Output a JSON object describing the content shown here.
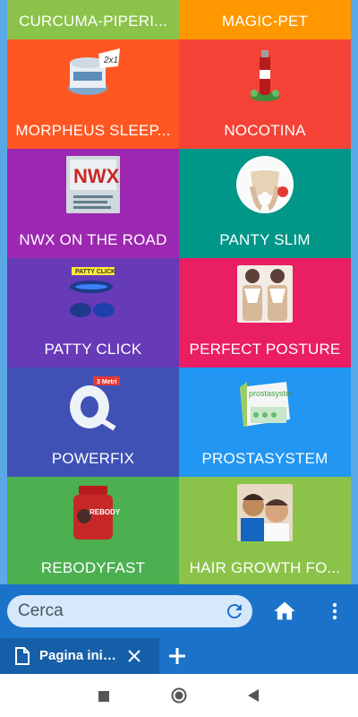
{
  "tiles": [
    {
      "label": "CURCUMA-PIPERI...",
      "color": "#8bc34a",
      "icon": "curcuma-product-image"
    },
    {
      "label": "MAGIC-PET",
      "color": "#ff9800",
      "icon": "magic-pet-product-image"
    },
    {
      "label": "MORPHEUS SLEEP...",
      "color": "#ff5722",
      "icon": "morpheus-sleep-product-image",
      "badge": "2x1"
    },
    {
      "label": "NOCOTINA",
      "color": "#f44336",
      "icon": "nocotina-product-image"
    },
    {
      "label": "NWX ON THE ROAD",
      "color": "#9c27b0",
      "icon": "nwx-product-image",
      "badge": "NWX"
    },
    {
      "label": "PANTY SLIM",
      "color": "#009688",
      "icon": "panty-slim-product-image"
    },
    {
      "label": "PATTY CLICK",
      "color": "#673ab7",
      "icon": "patty-click-product-image",
      "badge": "PATTY CLICK"
    },
    {
      "label": "PERFECT POSTURE",
      "color": "#e91e63",
      "icon": "perfect-posture-product-image"
    },
    {
      "label": "POWERFIX",
      "color": "#3f51b5",
      "icon": "powerfix-product-image",
      "badge": "3 Metri"
    },
    {
      "label": "PROSTASYSTEM",
      "color": "#2196f3",
      "icon": "prostasystem-product-image",
      "badge": "prostasystem"
    },
    {
      "label": "REBODYFAST",
      "color": "#4caf50",
      "icon": "rebodyfast-product-image",
      "badge": "REBODY FAST"
    },
    {
      "label": "HAIR GROWTH FO...",
      "color": "#8bc34a",
      "icon": "hair-growth-product-image"
    }
  ],
  "toolbar": {
    "search_placeholder": "Cerca",
    "refresh_icon": "refresh-icon",
    "home_icon": "home-icon",
    "menu_icon": "more-vert-icon",
    "color": "#1a73c9"
  },
  "tabs": {
    "active_label": "Pagina iniziale",
    "page_icon": "page-icon",
    "close_icon": "close-icon",
    "new_tab_icon": "plus-icon"
  },
  "navbar": {
    "recents_icon": "square-icon",
    "home_icon": "circle-icon",
    "back_icon": "back-triangle-icon"
  }
}
